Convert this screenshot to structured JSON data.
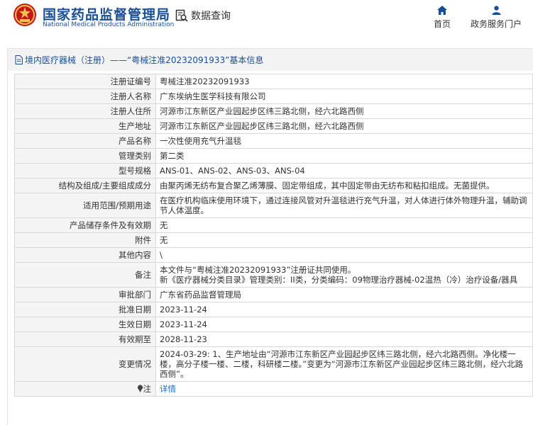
{
  "header": {
    "brand_cn": "国家药品监督管理局",
    "brand_en": "National Medical Products Administration",
    "data_query": "数据查询",
    "nav": [
      {
        "label": "首页",
        "icon": "home-icon"
      },
      {
        "label": "政务服务门户",
        "icon": "user-icon"
      }
    ],
    "colors": {
      "brand": "#1a4e95",
      "emblem_red": "#c8161d",
      "emblem_gold": "#f3c24a"
    }
  },
  "title": "境内医疗器械（注册）——“粤械注准20232091933”基本信息",
  "fields": [
    {
      "label": "注册证编号",
      "value": "粤械注准20232091933"
    },
    {
      "label": "注册人名称",
      "value": "广东埃纳生医学科技有限公司"
    },
    {
      "label": "注册人住所",
      "value": "河源市江东新区产业园起步区纬三路北侧，经六北路西侧"
    },
    {
      "label": "生产地址",
      "value": "河源市江东新区产业园起步区纬三路北侧，经六北路西侧"
    },
    {
      "label": "产品名称",
      "value": "一次性使用充气升温毯"
    },
    {
      "label": "管理类别",
      "value": "第二类"
    },
    {
      "label": "型号规格",
      "value": "ANS-01、ANS-02、ANS-03、ANS-04"
    },
    {
      "label": "结构及组成/主要组成成分",
      "value": "由聚丙烯无纺布复合聚乙烯薄膜、固定带组成，其中固定带由无纺布和粘扣组成。无菌提供。"
    },
    {
      "label": "适用范围/预期用途",
      "value": "在医疗机构临床使用环境下，通过连接风管对升温毯进行充气升温，对人体进行体外物理升温，辅助调节人体温度。"
    },
    {
      "label": "产品储存条件及有效期",
      "value": "无"
    },
    {
      "label": "附件",
      "value": "无"
    },
    {
      "label": "其他内容",
      "value": "\\"
    },
    {
      "label": "备注",
      "value_lines": [
        "本文件与“粤械注准20232091933”注册证共同使用。",
        "新《医疗器械分类目录》管理类别：II类，分类编码：09物理治疗器械-02温热（冷）治疗设备/器具"
      ]
    },
    {
      "label": "审批部门",
      "value": "广东省药品监督管理局"
    },
    {
      "label": "批准日期",
      "value": "2023-11-24"
    },
    {
      "label": "生效日期",
      "value": "2023-11-24"
    },
    {
      "label": "有效期至",
      "value": "2028-11-23"
    },
    {
      "label": "变更情况",
      "value": "2024-03-29: 1、生产地址由“河源市江东新区产业园起步区纬三路北侧，经六北路西侧。净化楼一楼，高分子楼一楼、二楼，科研楼二楼。”变更为“河源市江东新区产业园起步区纬三路北侧，经六北路西侧”。"
    }
  ],
  "note": {
    "label": "注",
    "icon": "pin-icon",
    "link": "详情"
  }
}
